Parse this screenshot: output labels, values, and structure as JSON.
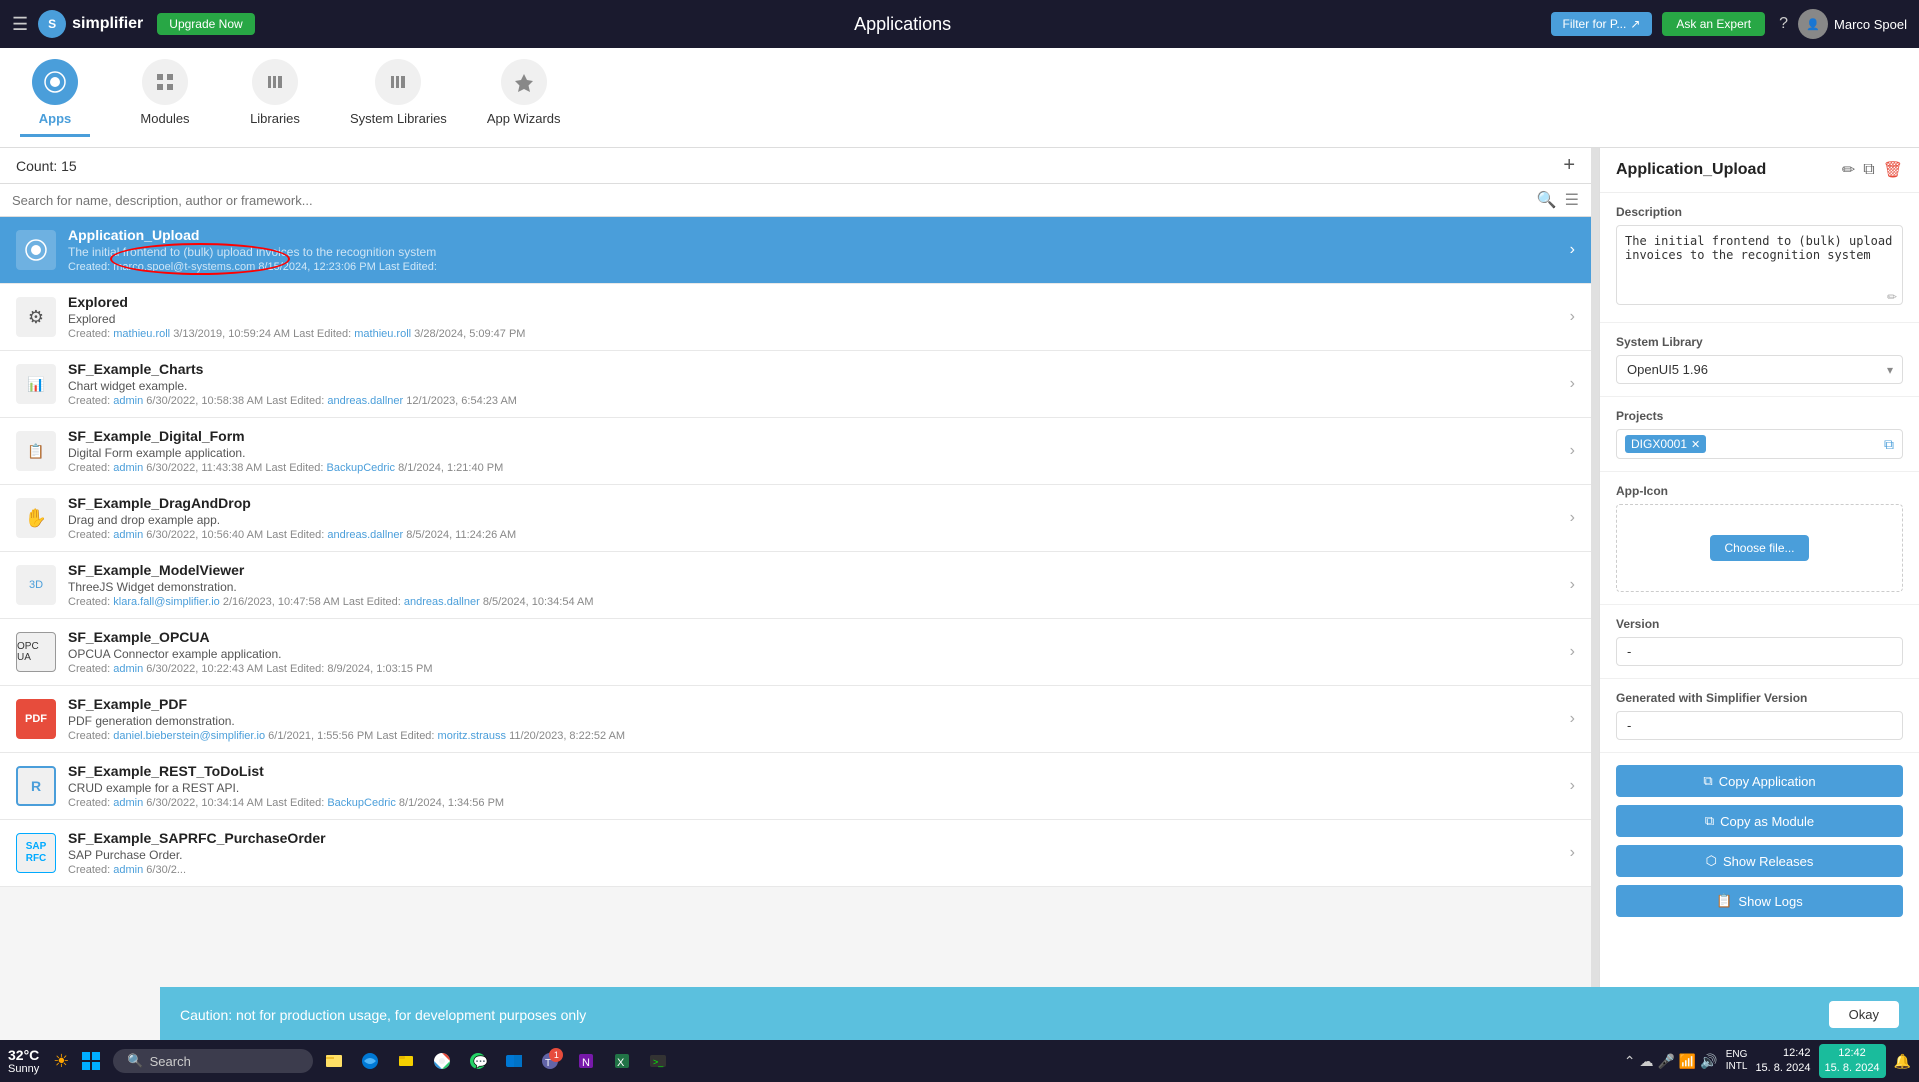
{
  "header": {
    "hamburger": "☰",
    "logo_initial": "S",
    "logo_text": "simplifier",
    "upgrade_label": "Upgrade Now",
    "title": "Applications",
    "filter_label": "Filter for P...",
    "ask_expert_label": "Ask an Expert",
    "user_name": "Marco Spoel"
  },
  "nav": {
    "tabs": [
      {
        "id": "apps",
        "label": "Apps",
        "icon": "⬡",
        "active": true
      },
      {
        "id": "modules",
        "label": "Modules",
        "icon": "☰",
        "active": false
      },
      {
        "id": "libraries",
        "label": "Libraries",
        "icon": "⬡",
        "active": false
      },
      {
        "id": "system-libraries",
        "label": "System Libraries",
        "icon": "⬡",
        "active": false
      },
      {
        "id": "app-wizards",
        "label": "App Wizards",
        "icon": "✦",
        "active": false
      }
    ]
  },
  "list": {
    "count_label": "Count: 15",
    "add_icon": "+",
    "search_placeholder": "Search for name, description, author or framework...",
    "apps": [
      {
        "id": "application-upload",
        "name": "Application_Upload",
        "desc": "The initial frontend to (bulk) upload invoices to the recognition system",
        "created_label": "Created:",
        "created_by": "marco.spoel@t-systems.com",
        "created_date": "8/15/2024, 12:23:06 PM",
        "last_edited_label": "Last Edited:",
        "last_edited_val": "",
        "selected": true,
        "icon": "⬡"
      },
      {
        "id": "explored",
        "name": "Explored",
        "desc": "Explored",
        "created_label": "Created:",
        "created_by": "mathieu.roll",
        "created_date": "3/13/2019, 10:59:24 AM",
        "last_edited_label": "Last Edited:",
        "last_edited_by": "mathieu.roll",
        "last_edited_date": "3/28/2024, 5:09:47 PM",
        "selected": false,
        "icon": "⚙"
      },
      {
        "id": "sf-example-charts",
        "name": "SF_Example_Charts",
        "desc": "Chart widget example.",
        "created_label": "Created:",
        "created_by": "admin",
        "created_date": "6/30/2022, 10:58:38 AM",
        "last_edited_label": "Last Edited:",
        "last_edited_by": "andreas.dallner",
        "last_edited_date": "12/1/2023, 6:54:23 AM",
        "selected": false,
        "icon": "📊"
      },
      {
        "id": "sf-example-digital-form",
        "name": "SF_Example_Digital_Form",
        "desc": "Digital Form example application.",
        "created_label": "Created:",
        "created_by": "admin",
        "created_date": "6/30/2022, 11:43:38 AM",
        "last_edited_label": "Last Edited:",
        "last_edited_by": "BackupCedric",
        "last_edited_date": "8/1/2024, 1:21:40 PM",
        "selected": false,
        "icon": "📋"
      },
      {
        "id": "sf-example-draganddrop",
        "name": "SF_Example_DragAndDrop",
        "desc": "Drag and drop example app.",
        "created_label": "Created:",
        "created_by": "admin",
        "created_date": "6/30/2022, 10:56:40 AM",
        "last_edited_label": "Last Edited:",
        "last_edited_by": "andreas.dallner",
        "last_edited_date": "8/5/2024, 11:24:26 AM",
        "selected": false,
        "icon": "✋"
      },
      {
        "id": "sf-example-modelviewer",
        "name": "SF_Example_ModelViewer",
        "desc": "ThreeJS Widget demonstration.",
        "created_label": "Created:",
        "created_by": "klara.fall@simplifier.io",
        "created_date": "2/16/2023, 10:47:58 AM",
        "last_edited_label": "Last Edited:",
        "last_edited_by": "andreas.dallner",
        "last_edited_date": "8/5/2024, 10:34:54 AM",
        "selected": false,
        "icon": "⬡"
      },
      {
        "id": "sf-example-opcua",
        "name": "SF_Example_OPCUA",
        "desc": "OPCUA Connector example application.",
        "created_label": "Created:",
        "created_by": "admin",
        "created_date": "6/30/2022, 10:22:43 AM",
        "last_edited_label": "Last Edited:",
        "last_edited_by": "",
        "last_edited_date": "8/9/2024, 1:03:15 PM",
        "selected": false,
        "icon": "⬡"
      },
      {
        "id": "sf-example-pdf",
        "name": "SF_Example_PDF",
        "desc": "PDF generation demonstration.",
        "created_label": "Created:",
        "created_by": "daniel.bieberstein@simplifier.io",
        "created_date": "6/1/2021, 1:55:56 PM",
        "last_edited_label": "Last Edited:",
        "last_edited_by": "moritz.strauss",
        "last_edited_date": "11/20/2023, 8:22:52 AM",
        "selected": false,
        "icon": "📄"
      },
      {
        "id": "sf-example-rest-todolist",
        "name": "SF_Example_REST_ToDoList",
        "desc": "CRUD example for a REST API.",
        "created_label": "Created:",
        "created_by": "admin",
        "created_date": "6/30/2022, 10:34:14 AM",
        "last_edited_label": "Last Edited:",
        "last_edited_by": "BackupCedric",
        "last_edited_date": "8/1/2024, 1:34:56 PM",
        "selected": false,
        "icon": "R"
      },
      {
        "id": "sf-example-saprfc",
        "name": "SF_Example_SAPRFC_PurchaseOrder",
        "desc": "SAP Purchase Order.",
        "created_label": "Created:",
        "created_by": "admin",
        "created_date": "6/30/2...",
        "last_edited_label": "",
        "last_edited_by": "",
        "last_edited_date": "",
        "selected": false,
        "icon": "⬡"
      }
    ]
  },
  "detail": {
    "title": "Application_Upload",
    "edit_icon": "✏",
    "copy_icon": "⧉",
    "delete_icon": "🗑",
    "description_label": "Description",
    "description_value": "The initial frontend to (bulk) upload invoices to the recognition system",
    "system_library_label": "System Library",
    "system_library_value": "OpenUI5 1.96",
    "projects_label": "Projects",
    "project_tag": "DIGX0001",
    "app_icon_label": "App-Icon",
    "choose_file_label": "Choose file...",
    "version_label": "Version",
    "version_value": "-",
    "generated_label": "Generated with Simplifier Version",
    "generated_value": "-",
    "copy_application_label": "Copy Application",
    "copy_as_module_label": "Copy as Module",
    "show_releases_label": "Show Releases",
    "show_logs_label": "Show Logs",
    "copy_icon_char": "⧉",
    "releases_icon": "⬡",
    "logs_icon": "📋"
  },
  "caution": {
    "message": "Caution: not for production usage, for development purposes only",
    "okay_label": "Okay"
  },
  "taskbar": {
    "temp": "32°C",
    "condition": "Sunny",
    "search_label": "Search",
    "clock_time": "12:42",
    "clock_date": "15. 8. 2024",
    "lang_line1": "ENG",
    "lang_line2": "INTL"
  }
}
